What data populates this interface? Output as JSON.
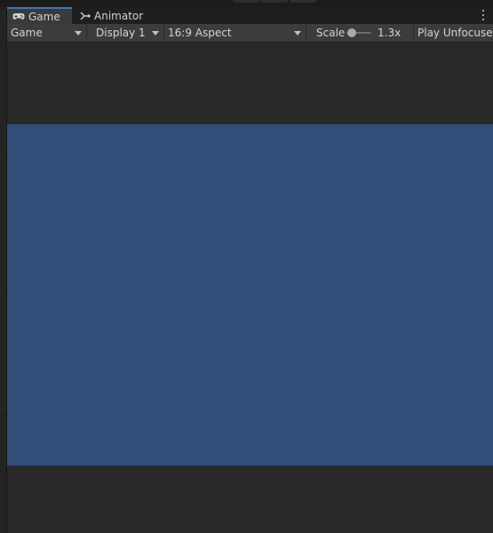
{
  "tabs": [
    {
      "label": "Game",
      "icon": "gamepad-icon",
      "active": true
    },
    {
      "label": "Animator",
      "icon": "animator-icon",
      "active": false
    }
  ],
  "toolbar": {
    "view_mode": "Game",
    "display": "Display 1",
    "aspect": "16:9 Aspect",
    "scale_label": "Scale",
    "scale_value": "1.3x",
    "play_mode": "Play Unfocused"
  },
  "colors": {
    "panel_bg": "#282828",
    "toolbar_bg": "#3c3c3c",
    "tab_active_accent": "#3a79bb",
    "render_clear_color": "#314d79"
  }
}
